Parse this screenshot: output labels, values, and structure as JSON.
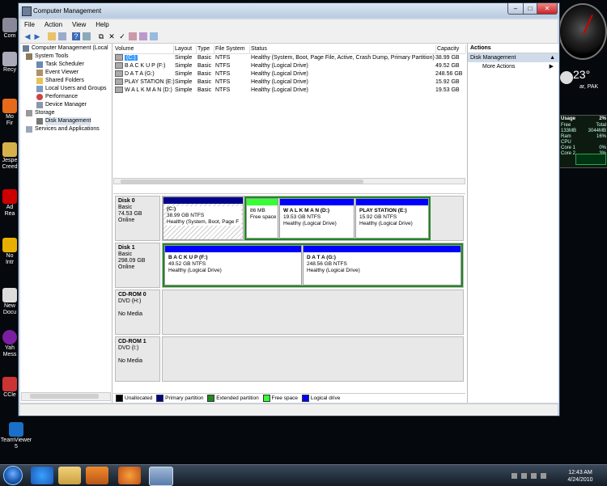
{
  "window": {
    "title": "Computer Management",
    "controls": {
      "minimize": "–",
      "maximize": "□",
      "close": "✕"
    }
  },
  "menu": [
    "File",
    "Action",
    "View",
    "Help"
  ],
  "tree": [
    {
      "label": "Computer Management (Local",
      "icon": "computer-icon"
    },
    {
      "label": "System Tools",
      "icon": "tools-icon"
    },
    {
      "label": "Task Scheduler",
      "icon": "clock-icon"
    },
    {
      "label": "Event Viewer",
      "icon": "event-viewer-icon"
    },
    {
      "label": "Shared Folders",
      "icon": "folder-icon"
    },
    {
      "label": "Local Users and Groups",
      "icon": "users-icon"
    },
    {
      "label": "Performance",
      "icon": "performance-icon"
    },
    {
      "label": "Device Manager",
      "icon": "device-icon"
    },
    {
      "label": "Storage",
      "icon": "storage-icon"
    },
    {
      "label": "Disk Management",
      "icon": "disk-icon"
    },
    {
      "label": "Services and Applications",
      "icon": "services-icon"
    }
  ],
  "volumes": {
    "headers": [
      "Volume",
      "Layout",
      "Type",
      "File System",
      "Status",
      "Capacity"
    ],
    "rows": [
      [
        "(C:)",
        "Simple",
        "Basic",
        "NTFS",
        "Healthy (System, Boot, Page File, Active, Crash Dump, Primary Partition)",
        "38.99 GB"
      ],
      [
        "B A C K  U P (F:)",
        "Simple",
        "Basic",
        "NTFS",
        "Healthy (Logical Drive)",
        "49.52 GB"
      ],
      [
        "D A T A (G:)",
        "Simple",
        "Basic",
        "NTFS",
        "Healthy (Logical Drive)",
        "248.56 GB"
      ],
      [
        "PLAY STATION (E:)",
        "Simple",
        "Basic",
        "NTFS",
        "Healthy (Logical Drive)",
        "15.92 GB"
      ],
      [
        "W A L K M A N (D:)",
        "Simple",
        "Basic",
        "NTFS",
        "Healthy (Logical Drive)",
        "19.53 GB"
      ]
    ]
  },
  "disks": [
    {
      "name": "Disk 0",
      "type": "Basic",
      "size": "74.53 GB",
      "state": "Online",
      "partitions": [
        {
          "name": "(C:)",
          "size": "38.99 GB NTFS",
          "status": "Healthy (System, Boot, Page F"
        },
        {
          "name": "",
          "size": "86 MB",
          "status": "Free space"
        },
        {
          "name": "W A L K M A N  (D:)",
          "size": "19.53 GB NTFS",
          "status": "Healthy (Logical Drive)"
        },
        {
          "name": "PLAY STATION  (E:)",
          "size": "15.92 GB NTFS",
          "status": "Healthy (Logical Drive)"
        }
      ]
    },
    {
      "name": "Disk 1",
      "type": "Basic",
      "size": "298.09 GB",
      "state": "Online",
      "partitions": [
        {
          "name": "B A C K  U P  (F:)",
          "size": "49.52 GB NTFS",
          "status": "Healthy (Logical Drive)"
        },
        {
          "name": "D A T A  (G:)",
          "size": "248.56 GB NTFS",
          "status": "Healthy (Logical Drive)"
        }
      ]
    },
    {
      "name": "CD-ROM 0",
      "type": "DVD (H:)",
      "state": "No Media"
    },
    {
      "name": "CD-ROM 1",
      "type": "DVD (I:)",
      "state": "No Media"
    }
  ],
  "legend": [
    {
      "label": "Unallocated",
      "color": "#000000"
    },
    {
      "label": "Primary partition",
      "color": "#00008b"
    },
    {
      "label": "Extended partition",
      "color": "#1f8a22"
    },
    {
      "label": "Free space",
      "color": "#33ff33"
    },
    {
      "label": "Logical drive",
      "color": "#0000ff"
    }
  ],
  "actions": {
    "header": "Actions",
    "section": "Disk Management",
    "item": "More Actions"
  },
  "desktop": {
    "icons": [
      "Com",
      "Recy",
      "Mo\nFir",
      "Jespe\nCreed",
      "Ad\nRea",
      "No\nIntr",
      "New\nDocu",
      "Yah\nMess",
      "CCle",
      "TeamViewer\n5"
    ],
    "weather": {
      "temp": "23°",
      "location": "ar, PAK"
    },
    "meter": {
      "title": "Usage",
      "pct": "2%",
      "free_label": "Free",
      "free": "133MB",
      "total_label": "Total",
      "total": "3044MB",
      "ram_label": "Ram",
      "ram": "16%",
      "cpu": "CPU",
      "core1_label": "Core 1",
      "core1": "0%",
      "core2_label": "Core 2",
      "core2": "3%"
    }
  },
  "taskbar": {
    "time": "12:43 AM",
    "date": "4/24/2010"
  }
}
